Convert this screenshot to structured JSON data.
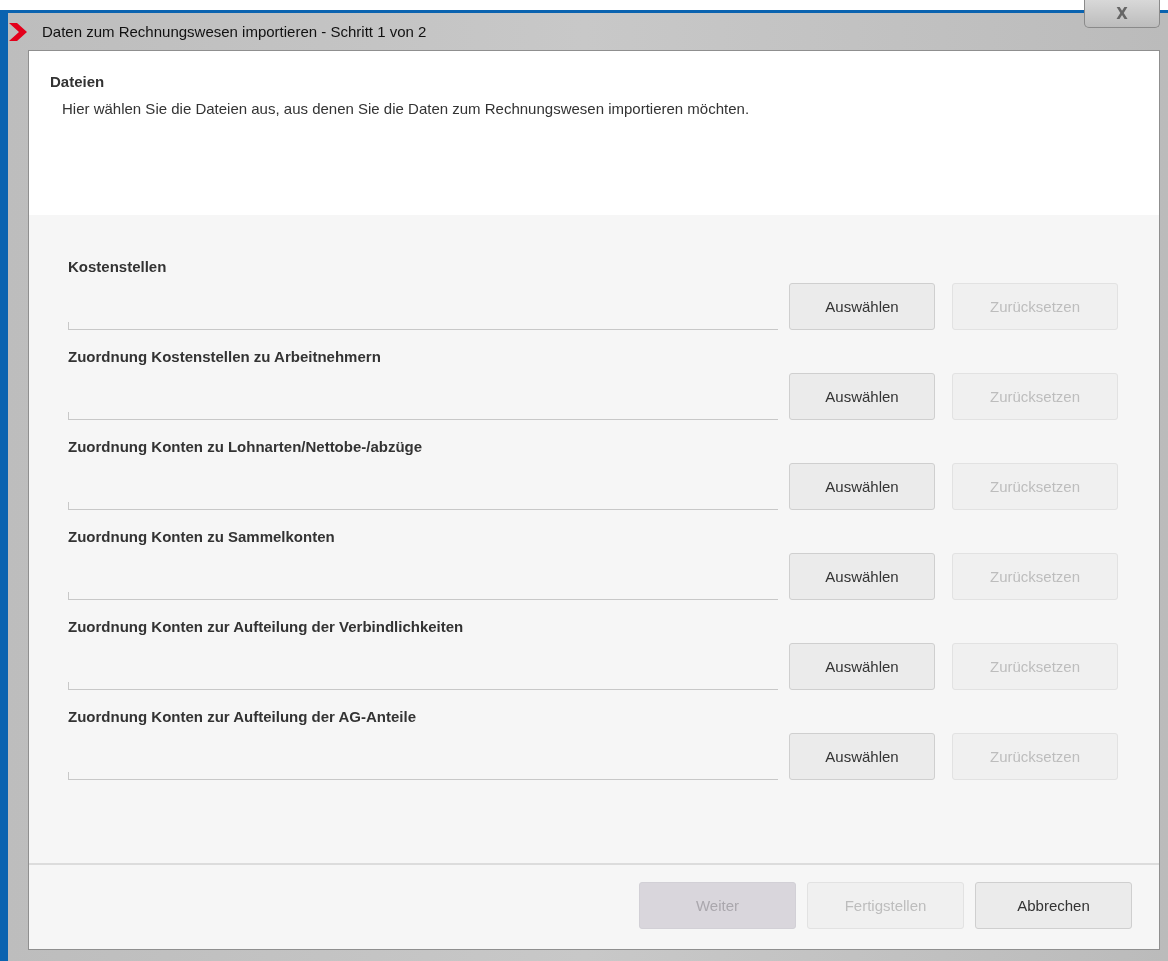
{
  "window": {
    "title": "Daten zum Rechnungswesen importieren - Schritt 1 von 2",
    "close_label": "X"
  },
  "header": {
    "title": "Dateien",
    "description": "Hier wählen Sie die Dateien aus, aus denen Sie die Daten zum Rechnungswesen importieren möchten."
  },
  "file_rows": [
    {
      "label": "Kostenstellen",
      "select_button": {
        "label": "Auswählen",
        "disabled": false
      },
      "reset_button": {
        "label": "Zurücksetzen",
        "disabled": true
      }
    },
    {
      "label": "Zuordnung Kostenstellen zu Arbeitnehmern",
      "select_button": {
        "label": "Auswählen",
        "disabled": false
      },
      "reset_button": {
        "label": "Zurücksetzen",
        "disabled": true
      }
    },
    {
      "label": "Zuordnung Konten zu Lohnarten/Nettobe-/abzüge",
      "select_button": {
        "label": "Auswählen",
        "disabled": false
      },
      "reset_button": {
        "label": "Zurücksetzen",
        "disabled": true
      }
    },
    {
      "label": "Zuordnung Konten zu Sammelkonten",
      "select_button": {
        "label": "Auswählen",
        "disabled": false
      },
      "reset_button": {
        "label": "Zurücksetzen",
        "disabled": true
      }
    },
    {
      "label": "Zuordnung Konten zur Aufteilung der Verbindlichkeiten",
      "select_button": {
        "label": "Auswählen",
        "disabled": false
      },
      "reset_button": {
        "label": "Zurücksetzen",
        "disabled": true
      }
    },
    {
      "label": "Zuordnung Konten zur Aufteilung der AG-Anteile",
      "select_button": {
        "label": "Auswählen",
        "disabled": false
      },
      "reset_button": {
        "label": "Zurücksetzen",
        "disabled": true
      }
    }
  ],
  "footer_buttons": [
    {
      "label": "Weiter",
      "disabled": true,
      "kind": "default"
    },
    {
      "label": "Fertigstellen",
      "disabled": true,
      "kind": "normal"
    },
    {
      "label": "Abbrechen",
      "disabled": false,
      "kind": "normal"
    }
  ]
}
